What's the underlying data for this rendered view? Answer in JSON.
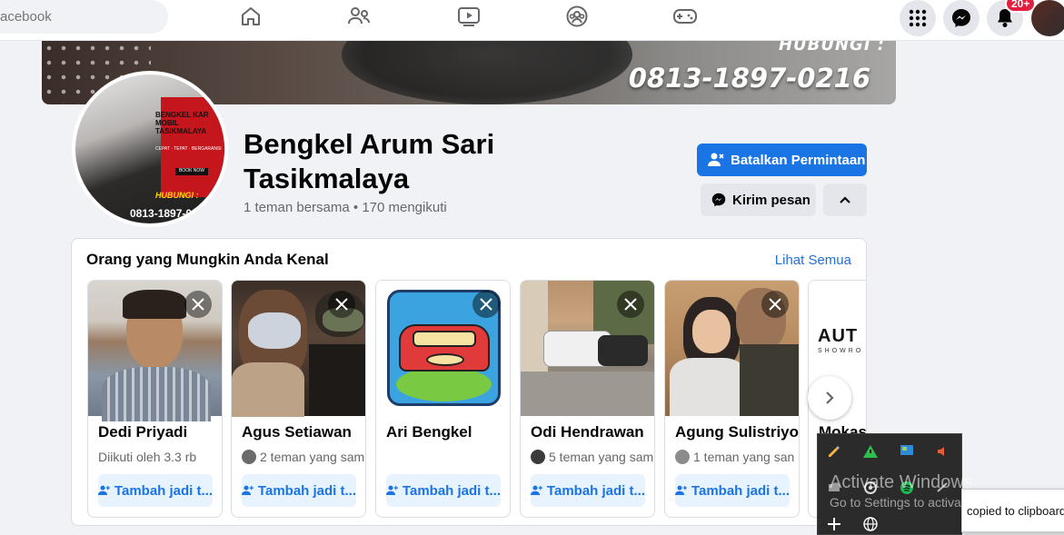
{
  "search": {
    "placeholder": "acebook"
  },
  "nav": {
    "notifications_badge": "20+"
  },
  "cover": {
    "hubungi": "HUBUNGI :",
    "phone": "0813-1897-0216"
  },
  "profile_pic": {
    "text": "BENGKEL KAR MOBIL TASIKMALAYA",
    "tagline": "CEPAT · TEPAT · BERGARANSI",
    "book": "BOOK NOW",
    "hubungi": "HUBUNGI :",
    "phone": "0813-1897-0"
  },
  "page": {
    "name": "Bengkel Arum Sari Tasikmalaya",
    "meta": "1 teman bersama • 170 mengikuti",
    "primary_button": "Batalkan Permintaan",
    "message_button": "Kirim pesan"
  },
  "suggestions": {
    "title": "Orang yang Mungkin Anda Kenal",
    "see_all": "Lihat Semua",
    "add_label": "Tambah jadi t...",
    "cards": [
      {
        "name": "Dedi Priyadi",
        "sub": "Diikuti oleh 3.3 rb"
      },
      {
        "name": "Agus Setiawan",
        "sub": "2 teman yang sam"
      },
      {
        "name": "Ari Bengkel",
        "sub": ""
      },
      {
        "name": "Odi Hendrawan",
        "sub": "5 teman yang sam"
      },
      {
        "name": "Agung Sulistriyo",
        "sub": "1 teman yang san"
      },
      {
        "name": "Mokas",
        "sub": "",
        "photo_text": "AUT",
        "photo_sub": "SHOWRO"
      }
    ]
  },
  "windows": {
    "activate_title": "Activate Windows",
    "activate_sub": "Go to Settings to activate Windows.",
    "toast": "copied to clipboard"
  }
}
